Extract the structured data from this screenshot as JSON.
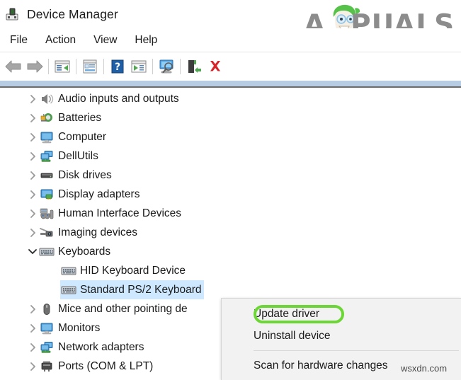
{
  "window": {
    "title": "Device Manager",
    "icon": "device-manager-icon"
  },
  "brand": {
    "watermark_logo": "APPUALS",
    "watermark_text": "wsxdn.com"
  },
  "menubar": {
    "items": [
      {
        "label": "File"
      },
      {
        "label": "Action"
      },
      {
        "label": "View"
      },
      {
        "label": "Help"
      }
    ]
  },
  "toolbar": {
    "buttons": [
      {
        "name": "back-arrow-icon",
        "tooltip": "Back"
      },
      {
        "name": "forward-arrow-icon",
        "tooltip": "Forward"
      },
      {
        "name": "show-hide-console-tree-icon",
        "tooltip": "Show/Hide Console Tree"
      },
      {
        "name": "properties-icon",
        "tooltip": "Properties"
      },
      {
        "name": "help-icon",
        "tooltip": "Help"
      },
      {
        "name": "update-driver-icon",
        "tooltip": "Update Driver Software"
      },
      {
        "name": "scan-hardware-changes-icon",
        "tooltip": "Scan for hardware changes"
      },
      {
        "name": "enable-device-icon",
        "tooltip": "Enable device"
      },
      {
        "name": "uninstall-device-icon",
        "tooltip": "Uninstall device"
      }
    ]
  },
  "tree": {
    "rows": [
      {
        "label": "Audio inputs and outputs",
        "icon": "speaker-icon",
        "indent": 1,
        "expander": "collapsed",
        "selected": false
      },
      {
        "label": "Batteries",
        "icon": "battery-icon",
        "indent": 1,
        "expander": "collapsed",
        "selected": false
      },
      {
        "label": "Computer",
        "icon": "computer-icon",
        "indent": 1,
        "expander": "collapsed",
        "selected": false
      },
      {
        "label": "DellUtils",
        "icon": "dell-utils-icon",
        "indent": 1,
        "expander": "collapsed",
        "selected": false
      },
      {
        "label": "Disk drives",
        "icon": "disk-drive-icon",
        "indent": 1,
        "expander": "collapsed",
        "selected": false
      },
      {
        "label": "Display adapters",
        "icon": "display-adapter-icon",
        "indent": 1,
        "expander": "collapsed",
        "selected": false
      },
      {
        "label": "Human Interface Devices",
        "icon": "hid-icon",
        "indent": 1,
        "expander": "collapsed",
        "selected": false
      },
      {
        "label": "Imaging devices",
        "icon": "camera-icon",
        "indent": 1,
        "expander": "collapsed",
        "selected": false
      },
      {
        "label": "Keyboards",
        "icon": "keyboard-icon",
        "indent": 1,
        "expander": "expanded",
        "selected": false
      },
      {
        "label": "HID Keyboard Device",
        "icon": "keyboard-icon",
        "indent": 2,
        "expander": "none",
        "selected": false
      },
      {
        "label": "Standard PS/2 Keyboard",
        "icon": "keyboard-icon",
        "indent": 2,
        "expander": "none",
        "selected": true
      },
      {
        "label": "Mice and other pointing de",
        "icon": "mouse-icon",
        "indent": 1,
        "expander": "collapsed",
        "selected": false
      },
      {
        "label": "Monitors",
        "icon": "monitor-icon",
        "indent": 1,
        "expander": "collapsed",
        "selected": false
      },
      {
        "label": "Network adapters",
        "icon": "network-adapter-icon",
        "indent": 1,
        "expander": "collapsed",
        "selected": false
      },
      {
        "label": "Ports (COM & LPT)",
        "icon": "port-icon",
        "indent": 1,
        "expander": "collapsed",
        "selected": false
      }
    ]
  },
  "context_menu": {
    "items": [
      {
        "label": "Update driver",
        "highlighted": true
      },
      {
        "label": "Uninstall device",
        "highlighted": false
      },
      {
        "label": "Scan for hardware changes",
        "highlighted": false
      }
    ]
  },
  "colors": {
    "selection": "#cde8ff",
    "annotation_ring": "#6cd637",
    "menu_background": "#f2f2f2",
    "band": "#b8cce4",
    "brand_gray": "#8c8c8c"
  }
}
